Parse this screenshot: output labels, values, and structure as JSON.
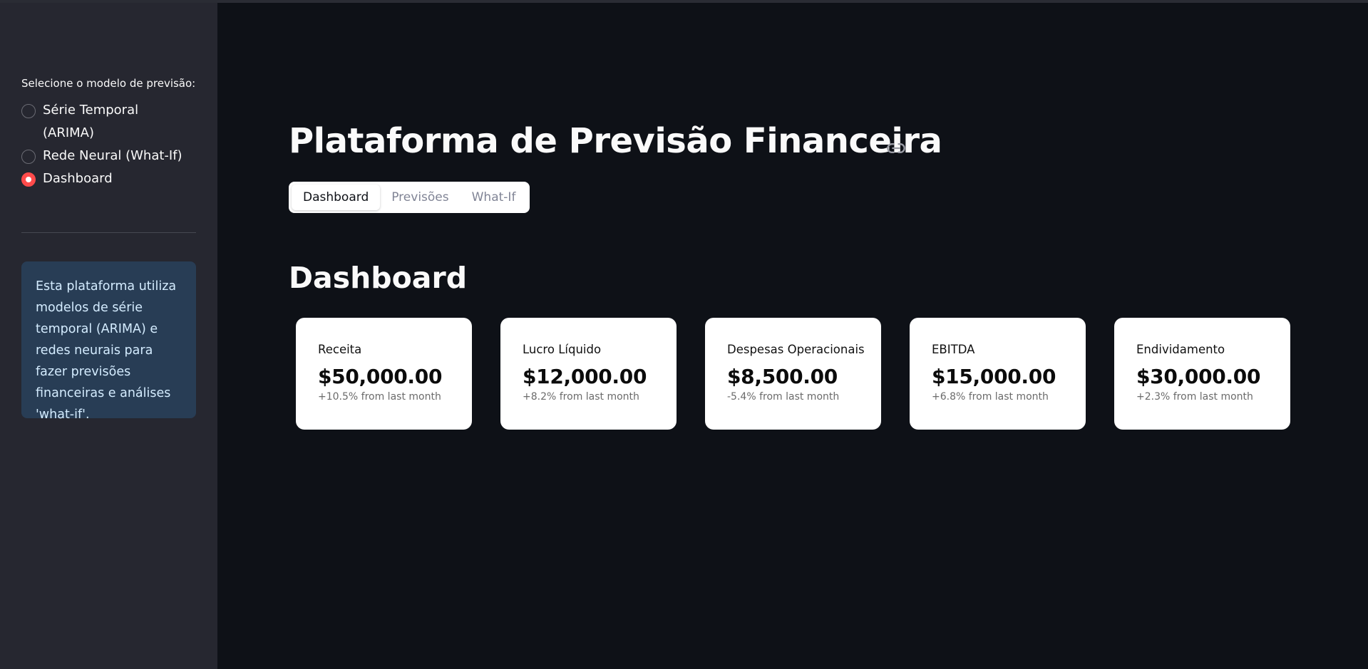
{
  "sidebar": {
    "radio_label": "Selecione o modelo de previsão:",
    "options": [
      {
        "label": "Série Temporal",
        "label_line2": "(ARIMA)",
        "selected": false
      },
      {
        "label": "Rede Neural (What-If)",
        "selected": false
      },
      {
        "label": "Dashboard",
        "selected": true
      }
    ],
    "info_text": "Esta plataforma utiliza modelos de série temporal (ARIMA) e redes neurais para fazer previsões financeiras e análises 'what-if'."
  },
  "header": {
    "title": "Plataforma de Previsão Financeira",
    "link_icon": "link-icon"
  },
  "tabs": [
    {
      "label": "Dashboard",
      "active": true
    },
    {
      "label": "Previsões",
      "active": false
    },
    {
      "label": "What-If",
      "active": false
    }
  ],
  "section_title": "Dashboard",
  "cards": [
    {
      "title": "Receita",
      "value": "$50,000.00",
      "change": "+10.5% from last month"
    },
    {
      "title": "Lucro Líquido",
      "value": "$12,000.00",
      "change": "+8.2% from last month"
    },
    {
      "title": "Despesas Operacionais",
      "value": "$8,500.00",
      "change": "-5.4% from last month"
    },
    {
      "title": "EBITDA",
      "value": "$15,000.00",
      "change": "+6.8% from last month"
    },
    {
      "title": "Endividamento",
      "value": "$30,000.00",
      "change": "+2.3% from last month"
    }
  ],
  "colors": {
    "accent": "#ff4b4b",
    "background": "#0e1117",
    "sidebar": "#262730",
    "info_box": "#283d55"
  }
}
